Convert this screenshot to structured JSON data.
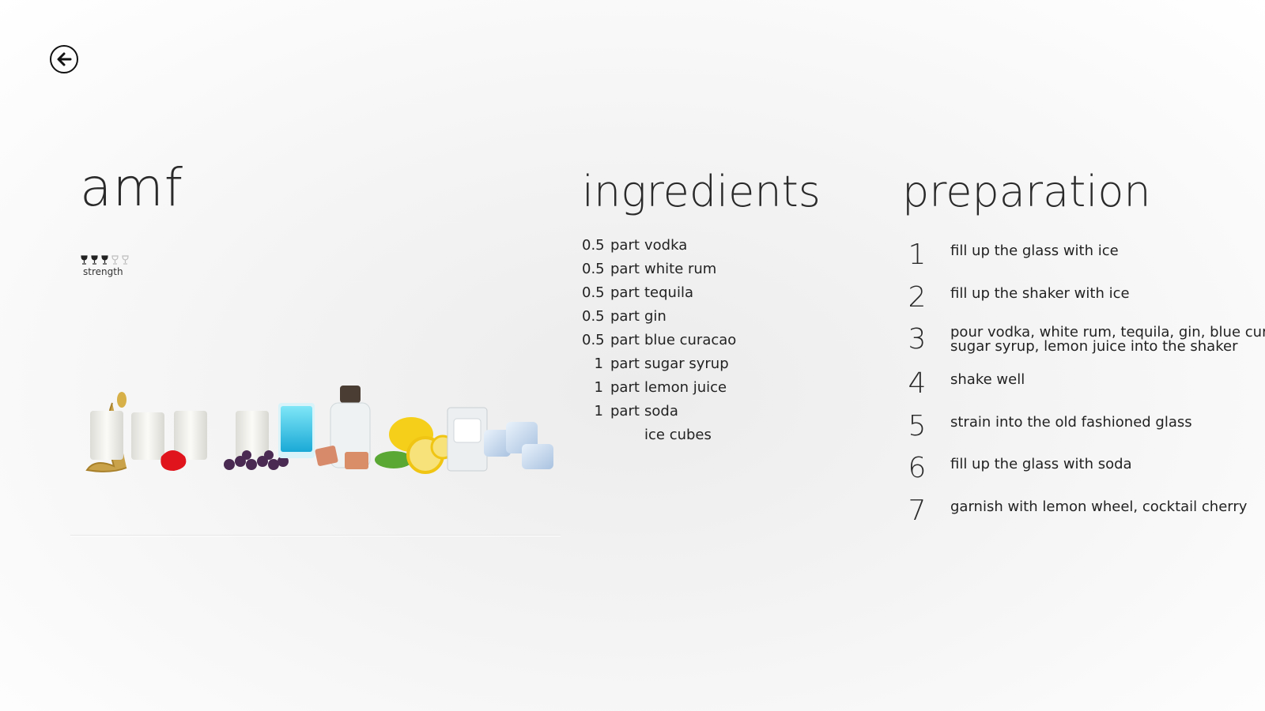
{
  "nav": {
    "back_icon": "arrow-left-icon"
  },
  "recipe": {
    "title": "amf",
    "strength": {
      "label": "strength",
      "level": 3,
      "max": 5
    }
  },
  "ingredients": {
    "heading": "ingredients",
    "items": [
      {
        "amount": "0.5",
        "unit": "part",
        "name": "vodka"
      },
      {
        "amount": "0.5",
        "unit": "part",
        "name": "white rum"
      },
      {
        "amount": "0.5",
        "unit": "part",
        "name": "tequila"
      },
      {
        "amount": "0.5",
        "unit": "part",
        "name": "gin"
      },
      {
        "amount": "0.5",
        "unit": "part",
        "name": "blue curacao"
      },
      {
        "amount": "1",
        "unit": "part",
        "name": "sugar syrup"
      },
      {
        "amount": "1",
        "unit": "part",
        "name": "lemon juice"
      },
      {
        "amount": "1",
        "unit": "part",
        "name": "soda"
      },
      {
        "amount": "",
        "unit": "",
        "name": "ice cubes"
      }
    ]
  },
  "preparation": {
    "heading": "preparation",
    "steps": [
      {
        "num": "1",
        "text": "fill up the glass with ice"
      },
      {
        "num": "2",
        "text": "fill up the shaker with ice"
      },
      {
        "num": "3",
        "text": "pour vodka, white rum, tequila, gin, blue curacao,",
        "text2": "sugar syrup, lemon juice into the shaker"
      },
      {
        "num": "4",
        "text": "shake well"
      },
      {
        "num": "5",
        "text": "strain into the old fashioned glass"
      },
      {
        "num": "6",
        "text": "fill up the glass with soda"
      },
      {
        "num": "7",
        "text": "garnish with lemon wheel, cocktail cherry"
      }
    ]
  },
  "colors": {
    "accent_blue": "#2ec5e6",
    "cherry_red": "#e0141c",
    "lemon_yellow": "#f5cf1a"
  }
}
